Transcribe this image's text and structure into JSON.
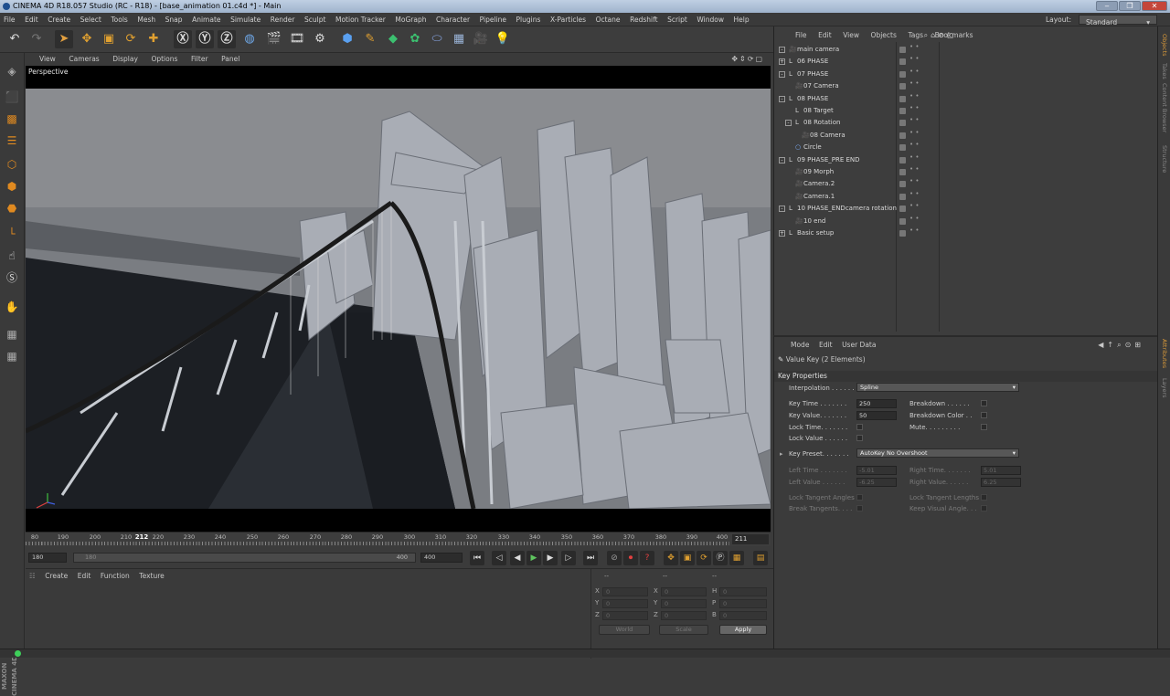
{
  "window": {
    "title": "CINEMA 4D R18.057 Studio (RC - R18) - [base_animation 01.c4d *] - Main",
    "min": "‒",
    "max": "❐",
    "close": "✕"
  },
  "menubar": {
    "items": [
      "File",
      "Edit",
      "Create",
      "Select",
      "Tools",
      "Mesh",
      "Snap",
      "Animate",
      "Simulate",
      "Render",
      "Sculpt",
      "Motion Tracker",
      "MoGraph",
      "Character",
      "Pipeline",
      "Plugins",
      "X-Particles",
      "Octane",
      "Redshift",
      "Script",
      "Window",
      "Help"
    ],
    "layout_label": "Layout:",
    "layout_value": "Standard"
  },
  "viewport": {
    "menu": [
      "View",
      "Cameras",
      "Display",
      "Options",
      "Filter",
      "Panel"
    ],
    "label": "Perspective",
    "nav_icons": "✥⇕⟳▢"
  },
  "timeline": {
    "ticks": [
      "80",
      "190",
      "200",
      "210",
      "220",
      "230",
      "240",
      "250",
      "260",
      "270",
      "280",
      "290",
      "300",
      "310",
      "320",
      "330",
      "340",
      "350",
      "360",
      "370",
      "380",
      "390",
      "400"
    ],
    "current_frame": "212",
    "frame_field": "211",
    "start": "180",
    "range_start": "180",
    "range_end": "400",
    "end": "400"
  },
  "material_manager": {
    "menu": [
      "Create",
      "Edit",
      "Function",
      "Texture"
    ]
  },
  "coordinates": {
    "header_a": "--",
    "header_b": "--",
    "header_c": "--",
    "rows": [
      {
        "a_label": "X",
        "a_val": "0",
        "b_label": "X",
        "b_val": "0",
        "c_label": "H",
        "c_val": "0"
      },
      {
        "a_label": "Y",
        "a_val": "0",
        "b_label": "Y",
        "b_val": "0",
        "c_label": "P",
        "c_val": "0"
      },
      {
        "a_label": "Z",
        "a_val": "0",
        "b_label": "Z",
        "b_val": "0",
        "c_label": "B",
        "c_val": "0"
      }
    ],
    "world": "World",
    "scale": "Scale",
    "apply": "Apply"
  },
  "object_manager": {
    "menu": [
      "File",
      "Edit",
      "View",
      "Objects",
      "Tags",
      "Bookmarks"
    ],
    "objects": [
      {
        "name": "main camera",
        "indent": 0,
        "exp": "-",
        "icon": "cam"
      },
      {
        "name": "06 PHASE",
        "indent": 0,
        "exp": "+",
        "icon": "null"
      },
      {
        "name": "07 PHASE",
        "indent": 0,
        "exp": "-",
        "icon": "null"
      },
      {
        "name": "07 Camera",
        "indent": 1,
        "exp": "",
        "icon": "cam"
      },
      {
        "name": "08 PHASE",
        "indent": 0,
        "exp": "-",
        "icon": "null"
      },
      {
        "name": "08 Target",
        "indent": 1,
        "exp": "",
        "icon": "null"
      },
      {
        "name": "08 Rotation",
        "indent": 1,
        "exp": "-",
        "icon": "null"
      },
      {
        "name": "08 Camera",
        "indent": 2,
        "exp": "",
        "icon": "cam"
      },
      {
        "name": "Circle",
        "indent": 1,
        "exp": "",
        "icon": "circle"
      },
      {
        "name": "09 PHASE_PRE END",
        "indent": 0,
        "exp": "-",
        "icon": "null"
      },
      {
        "name": "09 Morph",
        "indent": 1,
        "exp": "",
        "icon": "cam"
      },
      {
        "name": "Camera.2",
        "indent": 1,
        "exp": "",
        "icon": "cam"
      },
      {
        "name": "Camera.1",
        "indent": 1,
        "exp": "",
        "icon": "cam"
      },
      {
        "name": "10 PHASE_ENDcamera rotation",
        "indent": 0,
        "exp": "-",
        "icon": "null"
      },
      {
        "name": "10 end",
        "indent": 1,
        "exp": "",
        "icon": "cam"
      },
      {
        "name": "Basic setup",
        "indent": 0,
        "exp": "+",
        "icon": "null"
      }
    ]
  },
  "attribute_manager": {
    "menu": [
      "Mode",
      "Edit",
      "User Data"
    ],
    "header": "Value Key (2 Elements)",
    "section": "Key Properties",
    "interpolation_label": "Interpolation . . . . . . .",
    "interpolation_value": "Spline",
    "key_time_label": "Key Time . . . . . . .",
    "key_time_value": "250",
    "key_value_label": "Key Value. . . . . . .",
    "key_value_value": "50",
    "lock_time_label": "Lock Time. . . . . . .",
    "lock_value_label": "Lock Value . . . . . .",
    "breakdown_label": "Breakdown . . . . . .",
    "breakdown_color_label": "Breakdown Color . .",
    "mute_label": "Mute. . . . . . . . .",
    "key_preset_label": "Key Preset. . . . . . .",
    "key_preset_value": "AutoKey No Overshoot",
    "left_time_label": "Left Time . . . . . . .",
    "left_time_value": "-5.01",
    "left_value_label": "Left Value . . . . . .",
    "left_value_value": "-6.25",
    "right_time_label": "Right Time. . . . . . .",
    "right_time_value": "5.01",
    "right_value_label": "Right Value. . . . . .",
    "right_value_value": "6.25",
    "lock_tangent_angles": "Lock Tangent Angles",
    "lock_tangent_lengths": "Lock Tangent Lengths",
    "break_tangents": "Break Tangents. . . .",
    "keep_visual_angle": "Keep Visual Angle. . ."
  },
  "side_tabs": [
    "Objects",
    "Takes",
    "Content Browser",
    "Structure"
  ],
  "side_tabs_attr": [
    "Attributes",
    "Layers"
  ],
  "colors": {
    "accent": "#e0a030",
    "bg": "#3b3b3b"
  }
}
